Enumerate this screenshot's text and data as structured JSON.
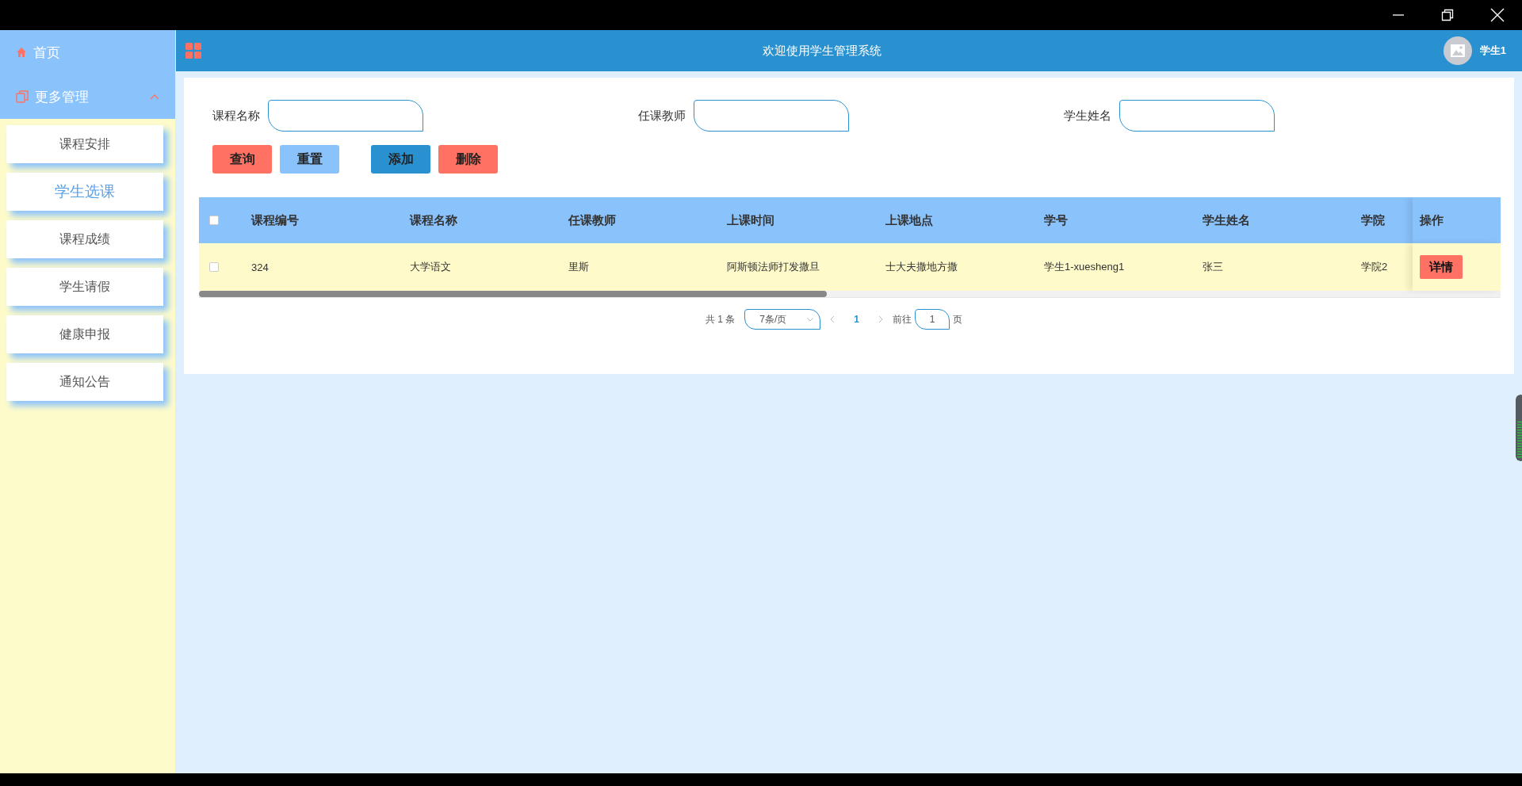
{
  "sidebar": {
    "items": [
      {
        "label": "首页",
        "kind": "link"
      },
      {
        "label": "更多管理",
        "kind": "group",
        "expanded": true,
        "children": [
          {
            "label": "课程安排",
            "selected": false
          },
          {
            "label": "学生选课",
            "selected": true
          },
          {
            "label": "课程成绩",
            "selected": false
          },
          {
            "label": "学生请假",
            "selected": false
          },
          {
            "label": "健康申报",
            "selected": false
          },
          {
            "label": "通知公告",
            "selected": false
          }
        ]
      }
    ]
  },
  "header": {
    "title": "欢迎使用学生管理系统",
    "user": "学生1"
  },
  "search": {
    "fields": [
      {
        "label": "课程名称"
      },
      {
        "label": "任课教师"
      },
      {
        "label": "学生姓名"
      }
    ],
    "buttons": [
      {
        "label": "查询",
        "color": "#ff7163"
      },
      {
        "label": "重置",
        "color": "#8ac2fb"
      },
      {
        "label": "添加",
        "color": "#2a91d0"
      },
      {
        "label": "删除",
        "color": "#ff7163"
      }
    ]
  },
  "table": {
    "select_all": false,
    "columns": [
      "课程编号",
      "课程名称",
      "任课教师",
      "上课时间",
      "上课地点",
      "学号",
      "学生姓名",
      "学院"
    ],
    "action_column": "操作",
    "rows": [
      {
        "checked": false,
        "cells": [
          "324",
          "大学语文",
          "里斯",
          "阿斯顿法师打发撒旦",
          "士大夫撒地方撒",
          "学生1-xuesheng1",
          "张三",
          "学院2"
        ],
        "action": "详情"
      }
    ]
  },
  "pagination": {
    "total": "共 1 条",
    "page_size": "7条/页",
    "pages": [
      {
        "label": "1",
        "selected": true
      }
    ],
    "goto_label": "前往",
    "goto_value": "1",
    "page_suffix": "页"
  }
}
